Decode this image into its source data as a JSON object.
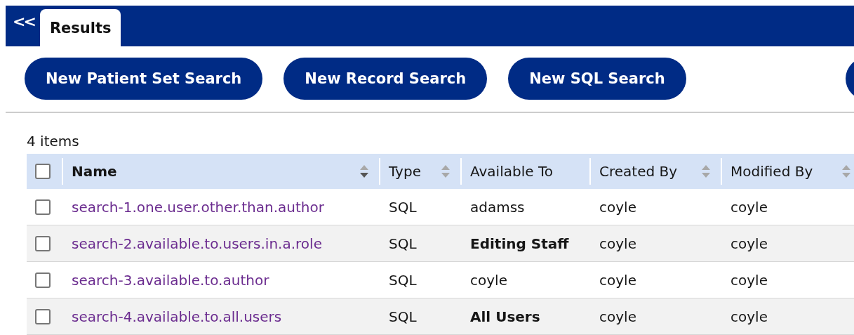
{
  "header": {
    "collapse_icon": "<<",
    "tabs": [
      {
        "label": "Results",
        "selected": true
      }
    ]
  },
  "toolbar": {
    "buttons": [
      "New Patient Set Search",
      "New Record Search",
      "New SQL Search"
    ]
  },
  "item_count": "4 items",
  "table": {
    "select_all": {
      "checked": false
    },
    "columns": [
      {
        "label": "Name",
        "sortable": true,
        "sorted": true
      },
      {
        "label": "Type",
        "sortable": true,
        "sorted": false
      },
      {
        "label": "Available To",
        "sortable": false
      },
      {
        "label": "Created By",
        "sortable": true,
        "sorted": false
      },
      {
        "label": "Modified By",
        "sortable": true,
        "sorted": false
      }
    ],
    "rows": [
      {
        "checked": false,
        "name": "search-1.one.user.other.than.author",
        "type": "SQL",
        "available_to": {
          "text": "adamss",
          "kind": "user"
        },
        "created_by": "coyle",
        "modified_by": "coyle"
      },
      {
        "checked": false,
        "name": "search-2.available.to.users.in.a.role",
        "type": "SQL",
        "available_to": {
          "text": "Editing Staff",
          "kind": "group"
        },
        "created_by": "coyle",
        "modified_by": "coyle"
      },
      {
        "checked": false,
        "name": "search-3.available.to.author",
        "type": "SQL",
        "available_to": {
          "text": "coyle",
          "kind": "user"
        },
        "created_by": "coyle",
        "modified_by": "coyle"
      },
      {
        "checked": false,
        "name": "search-4.available.to.all.users",
        "type": "SQL",
        "available_to": {
          "text": "All Users",
          "kind": "group"
        },
        "created_by": "coyle",
        "modified_by": "coyle"
      }
    ]
  }
}
